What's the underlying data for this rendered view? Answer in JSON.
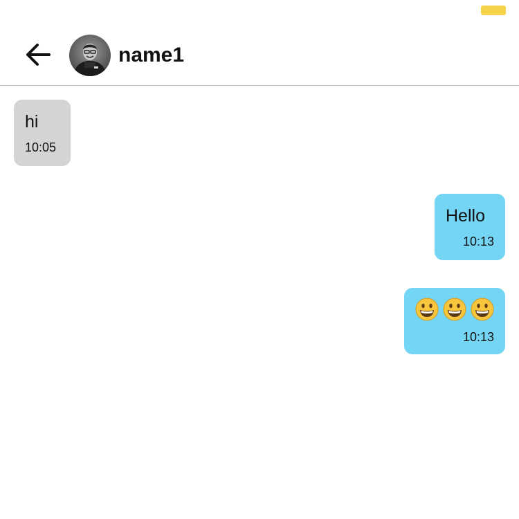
{
  "header": {
    "contact_name": "name1",
    "back_icon": "arrow-left-icon",
    "avatar_icon": "contact-avatar"
  },
  "status_bar": {
    "indicator_color": "#f6d449"
  },
  "colors": {
    "incoming_bubble": "#d4d4d4",
    "outgoing_bubble": "#75d5f5",
    "divider": "#bdbdbd"
  },
  "messages": [
    {
      "direction": "incoming",
      "text": "hi",
      "time": "10:05"
    },
    {
      "direction": "outgoing",
      "text": "Hello",
      "time": "10:13"
    },
    {
      "direction": "outgoing",
      "text": "😀😀😀",
      "emoji": [
        "grinning-face",
        "grinning-face",
        "grinning-face"
      ],
      "time": "10:13"
    }
  ]
}
